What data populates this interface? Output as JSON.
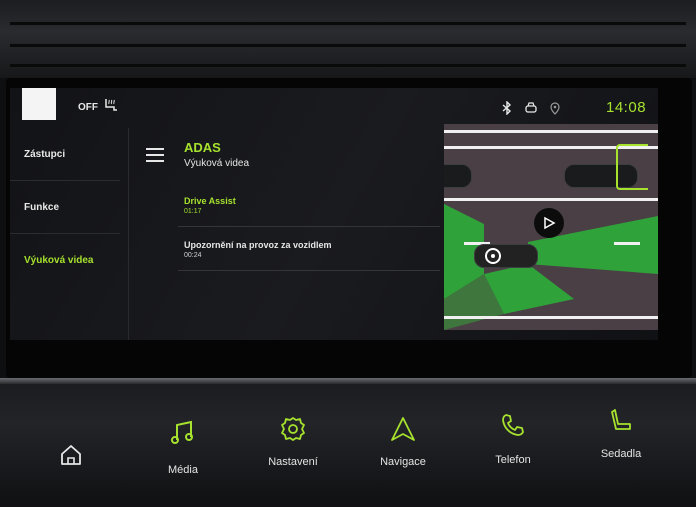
{
  "status_bar": {
    "ac_status": "OFF",
    "clock": "14:08"
  },
  "left_menu": {
    "items": [
      {
        "label": "Zástupci",
        "active": false
      },
      {
        "label": "Funkce",
        "active": false
      },
      {
        "label": "Výuková videa",
        "active": true
      }
    ]
  },
  "content": {
    "title": "ADAS",
    "subtitle": "Výuková videa",
    "videos": [
      {
        "title": "Drive Assist",
        "duration": "01:17",
        "selected": true
      },
      {
        "title": "Upozornění na provoz za vozidlem",
        "duration": "00:24",
        "selected": false
      }
    ]
  },
  "bottom_bar": {
    "buttons": [
      {
        "icon": "home-icon",
        "label": ""
      },
      {
        "icon": "music-note-icon",
        "label": "Média"
      },
      {
        "icon": "gear-icon",
        "label": "Nastavení"
      },
      {
        "icon": "navigation-arrow-icon",
        "label": "Navigace"
      },
      {
        "icon": "phone-icon",
        "label": "Telefon"
      },
      {
        "icon": "seat-icon",
        "label": "Sedadla"
      }
    ]
  },
  "colors": {
    "accent": "#a6e22e",
    "screen_bg": "#16171a",
    "text": "#e6e6e6"
  }
}
